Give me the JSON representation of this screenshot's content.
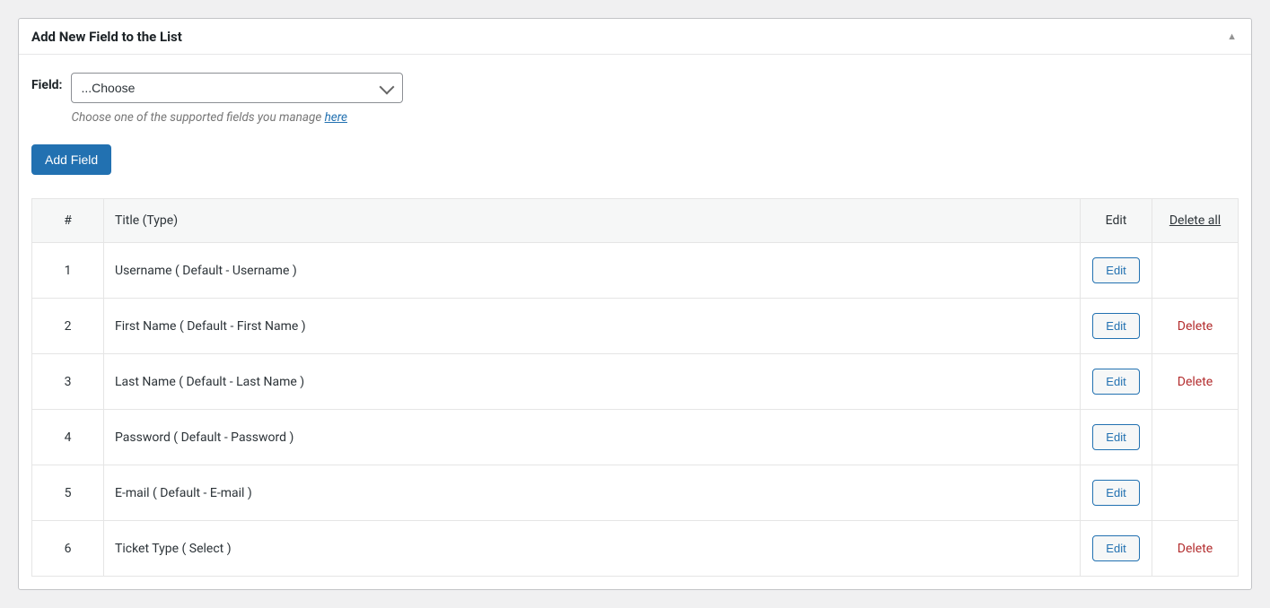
{
  "panel": {
    "title": "Add New Field to the List",
    "field_label": "Field:",
    "select_value": "...Choose",
    "hint_prefix": "Choose one of the supported fields you manage ",
    "hint_link": "here",
    "add_button": "Add Field"
  },
  "table": {
    "headers": {
      "num": "#",
      "title": "Title (Type)",
      "edit": "Edit",
      "delete_all": "Delete all"
    },
    "edit_label": "Edit",
    "delete_label": "Delete",
    "rows": [
      {
        "num": "1",
        "title": "Username ( Default - Username )",
        "deletable": false
      },
      {
        "num": "2",
        "title": "First Name ( Default - First Name )",
        "deletable": true
      },
      {
        "num": "3",
        "title": "Last Name ( Default - Last Name )",
        "deletable": true
      },
      {
        "num": "4",
        "title": "Password ( Default - Password )",
        "deletable": false
      },
      {
        "num": "5",
        "title": "E-mail ( Default - E-mail )",
        "deletable": false
      },
      {
        "num": "6",
        "title": "Ticket Type ( Select )",
        "deletable": true
      }
    ]
  }
}
